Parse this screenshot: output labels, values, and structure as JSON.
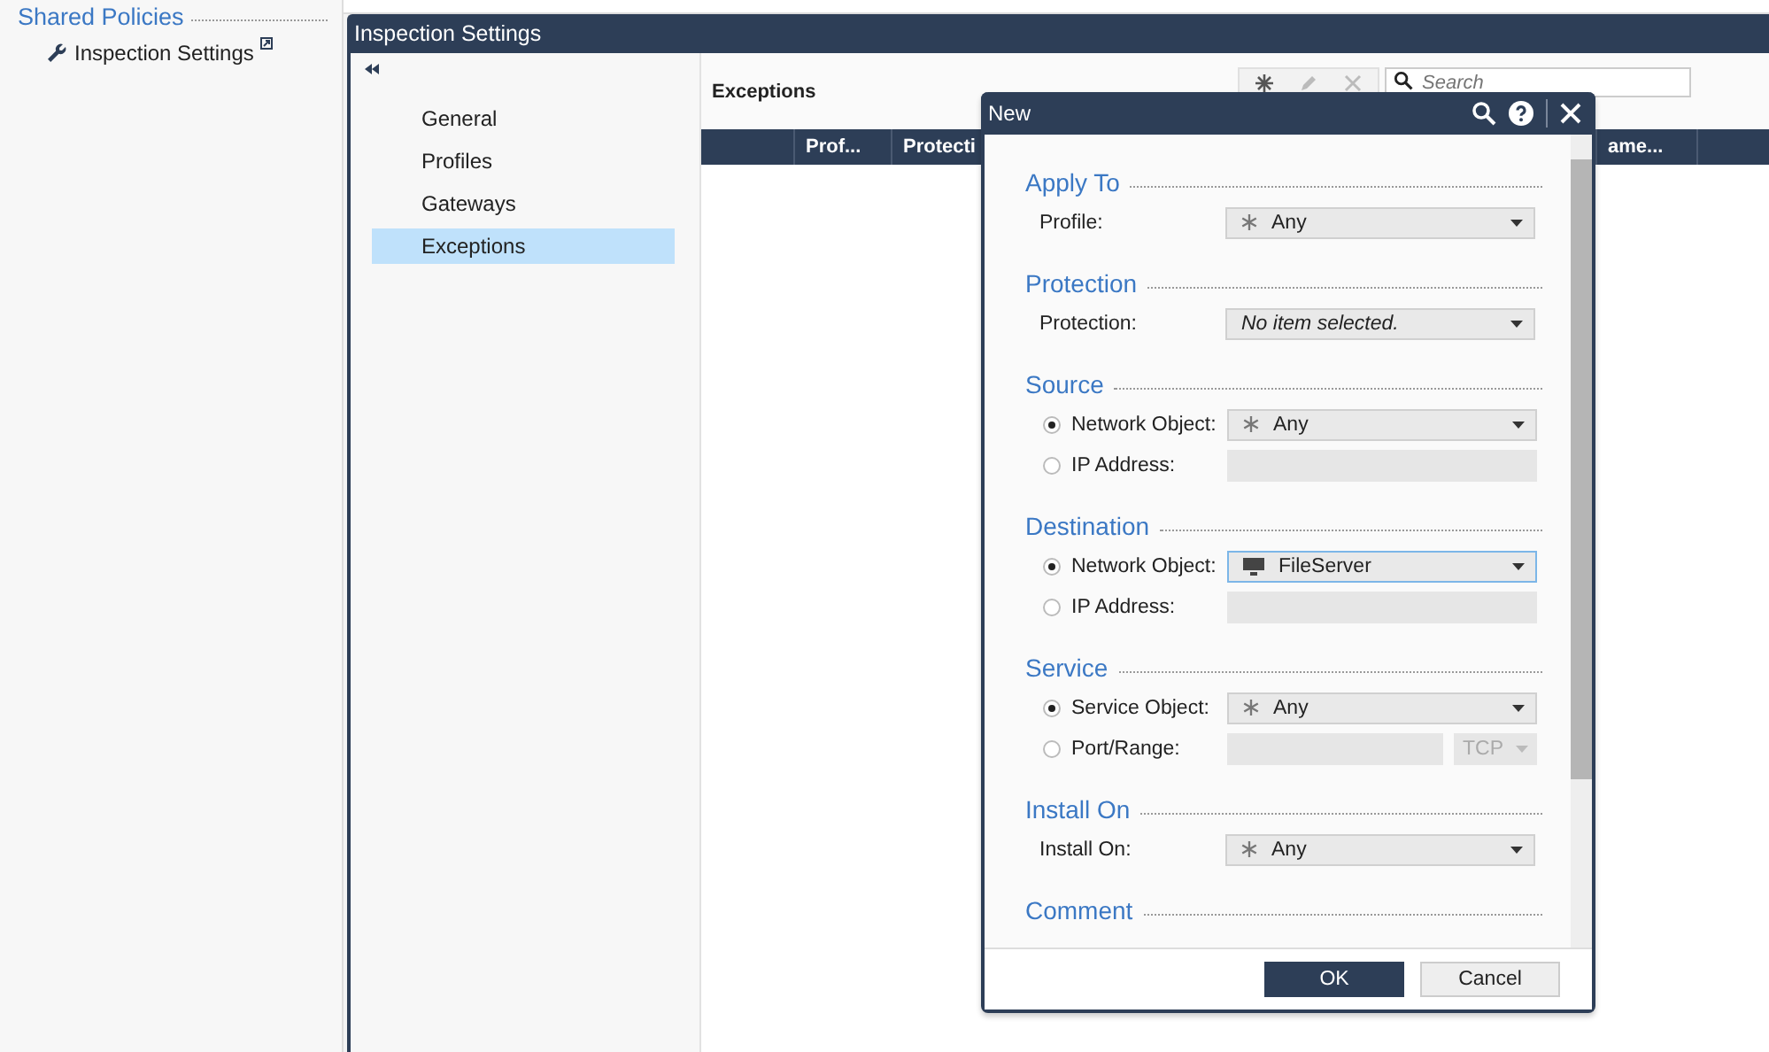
{
  "background": {
    "section_title": "Shared Policies",
    "item": {
      "label": "Inspection Settings"
    }
  },
  "window": {
    "title": "Inspection Settings",
    "nav": [
      {
        "label": "General",
        "selected": false
      },
      {
        "label": "Profiles",
        "selected": false
      },
      {
        "label": "Gateways",
        "selected": false
      },
      {
        "label": "Exceptions",
        "selected": true
      }
    ],
    "content": {
      "title": "Exceptions",
      "search": {
        "placeholder": "Search"
      },
      "table": {
        "columns": [
          "Prof...",
          "Protecti",
          "ame..."
        ]
      }
    }
  },
  "dialog": {
    "title": "New",
    "sections": [
      {
        "title": "Apply To",
        "rows": [
          {
            "kind": "plain",
            "label": "Profile:",
            "field": {
              "kind": "any",
              "value": "Any",
              "disabled": false,
              "focused": false
            }
          }
        ]
      },
      {
        "title": "Protection",
        "rows": [
          {
            "kind": "plain",
            "label": "Protection:",
            "field": {
              "kind": "select",
              "placeholder": "No item selected.",
              "disabled": false,
              "focused": false
            }
          }
        ]
      },
      {
        "title": "Source",
        "rows": [
          {
            "kind": "radio",
            "label": "Network Object:",
            "selected": true,
            "field": {
              "kind": "any",
              "value": "Any",
              "disabled": false,
              "focused": false
            }
          },
          {
            "kind": "radio",
            "label": "IP Address:",
            "selected": false,
            "field": {
              "kind": "text",
              "disabled": true
            }
          }
        ]
      },
      {
        "title": "Destination",
        "rows": [
          {
            "kind": "radio",
            "label": "Network Object:",
            "selected": true,
            "field": {
              "kind": "host",
              "value": "FileServer",
              "disabled": false,
              "focused": true
            }
          },
          {
            "kind": "radio",
            "label": "IP Address:",
            "selected": false,
            "field": {
              "kind": "text",
              "disabled": true
            }
          }
        ]
      },
      {
        "title": "Service",
        "rows": [
          {
            "kind": "radio",
            "label": "Service Object:",
            "selected": true,
            "field": {
              "kind": "any",
              "value": "Any",
              "disabled": false,
              "focused": false
            }
          },
          {
            "kind": "radio",
            "label": "Port/Range:",
            "selected": false,
            "field": {
              "kind": "port",
              "protocol": "TCP",
              "disabled": true
            }
          }
        ]
      },
      {
        "title": "Install On",
        "rows": [
          {
            "kind": "plain",
            "label": "Install On:",
            "field": {
              "kind": "any",
              "value": "Any",
              "disabled": false,
              "focused": false
            }
          }
        ]
      },
      {
        "title": "Comment"
      }
    ],
    "buttons": [
      {
        "label": "OK",
        "kind": "primary"
      },
      {
        "label": "Cancel",
        "kind": "secondary"
      }
    ]
  }
}
